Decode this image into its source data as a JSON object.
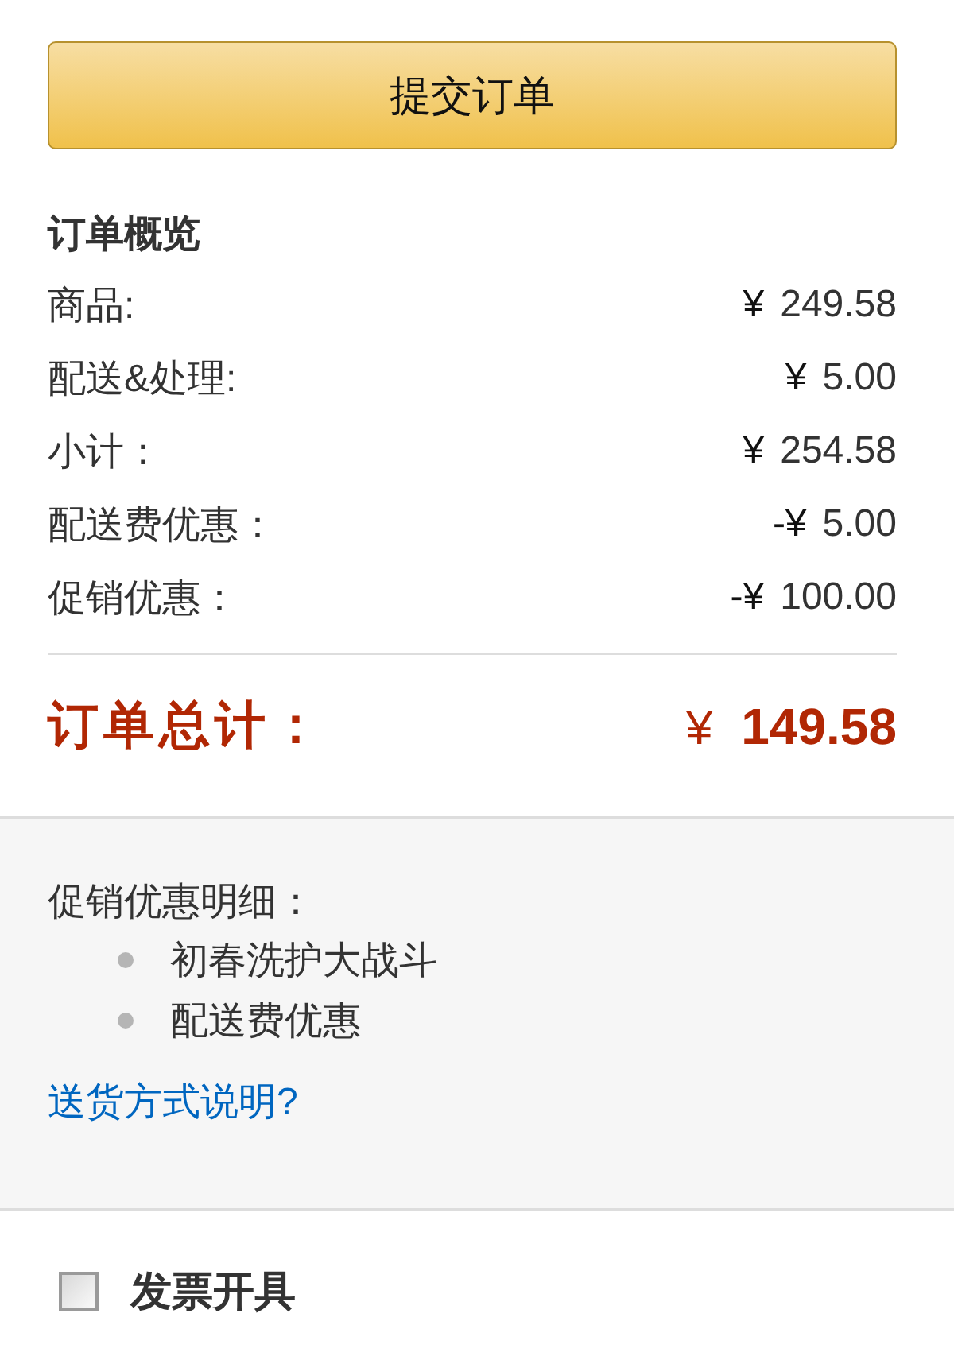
{
  "submit_button": {
    "label": "提交订单"
  },
  "summary": {
    "title": "订单概览",
    "rows": [
      {
        "label": "商品:",
        "currency": "¥",
        "amount": "249.58"
      },
      {
        "label": "配送&处理:",
        "currency": "¥",
        "amount": "5.00"
      },
      {
        "label": "小计：",
        "currency": "¥",
        "amount": "254.58"
      },
      {
        "label": "配送费优惠：",
        "currency": "-¥",
        "amount": "5.00"
      },
      {
        "label": "促销优惠：",
        "currency": "-¥",
        "amount": "100.00"
      }
    ],
    "total": {
      "label": "订单总计：",
      "currency": "¥",
      "amount": "149.58"
    }
  },
  "promotions": {
    "title": "促销优惠明细：",
    "items": [
      "初春洗护大战斗",
      "配送费优惠"
    ],
    "link": "送货方式说明?"
  },
  "invoice": {
    "label": "发票开具",
    "checked": false
  }
}
